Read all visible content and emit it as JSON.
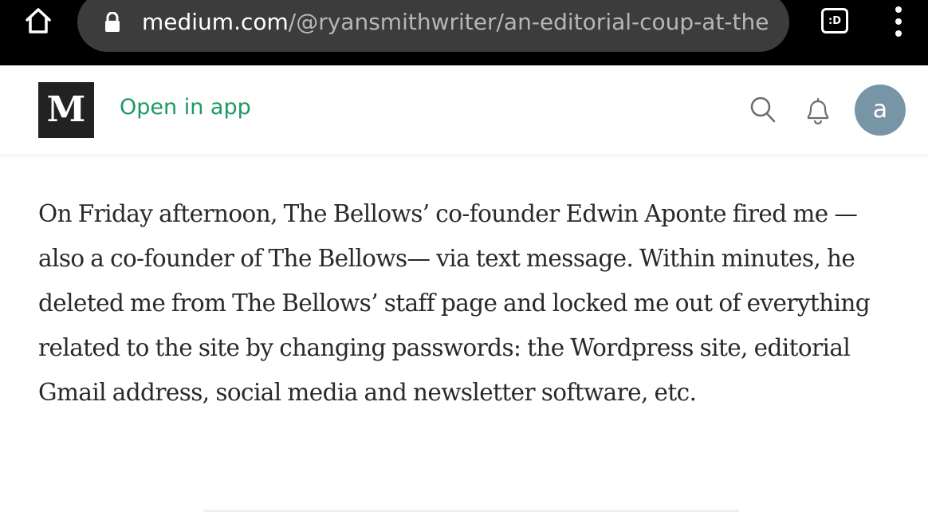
{
  "browser": {
    "url_host": "medium.com",
    "url_path": "/@ryansmithwriter/an-editorial-coup-at-the",
    "tabs_label": ":D",
    "icons": {
      "home": "home-icon",
      "lock": "lock-icon",
      "menu": "more-vert-icon"
    }
  },
  "header": {
    "logo_letter": "M",
    "open_in_app": "Open in app",
    "avatar_letter": "a",
    "icons": {
      "search": "search-icon",
      "notifications": "bell-icon"
    },
    "colors": {
      "open_in_app": "#1c9963",
      "avatar_bg": "#7895a6",
      "logo_bg": "#222222"
    }
  },
  "article": {
    "paragraph": "On Friday afternoon, The Bellows’ co-founder Edwin Aponte fired me — also a co-founder of The Bellows— via text message. Within minutes, he deleted me from The Bellows’ staff page and locked me out of everything related to the site by changing passwords: the Wordpress site, editorial Gmail address, social media and newsletter software, etc."
  }
}
